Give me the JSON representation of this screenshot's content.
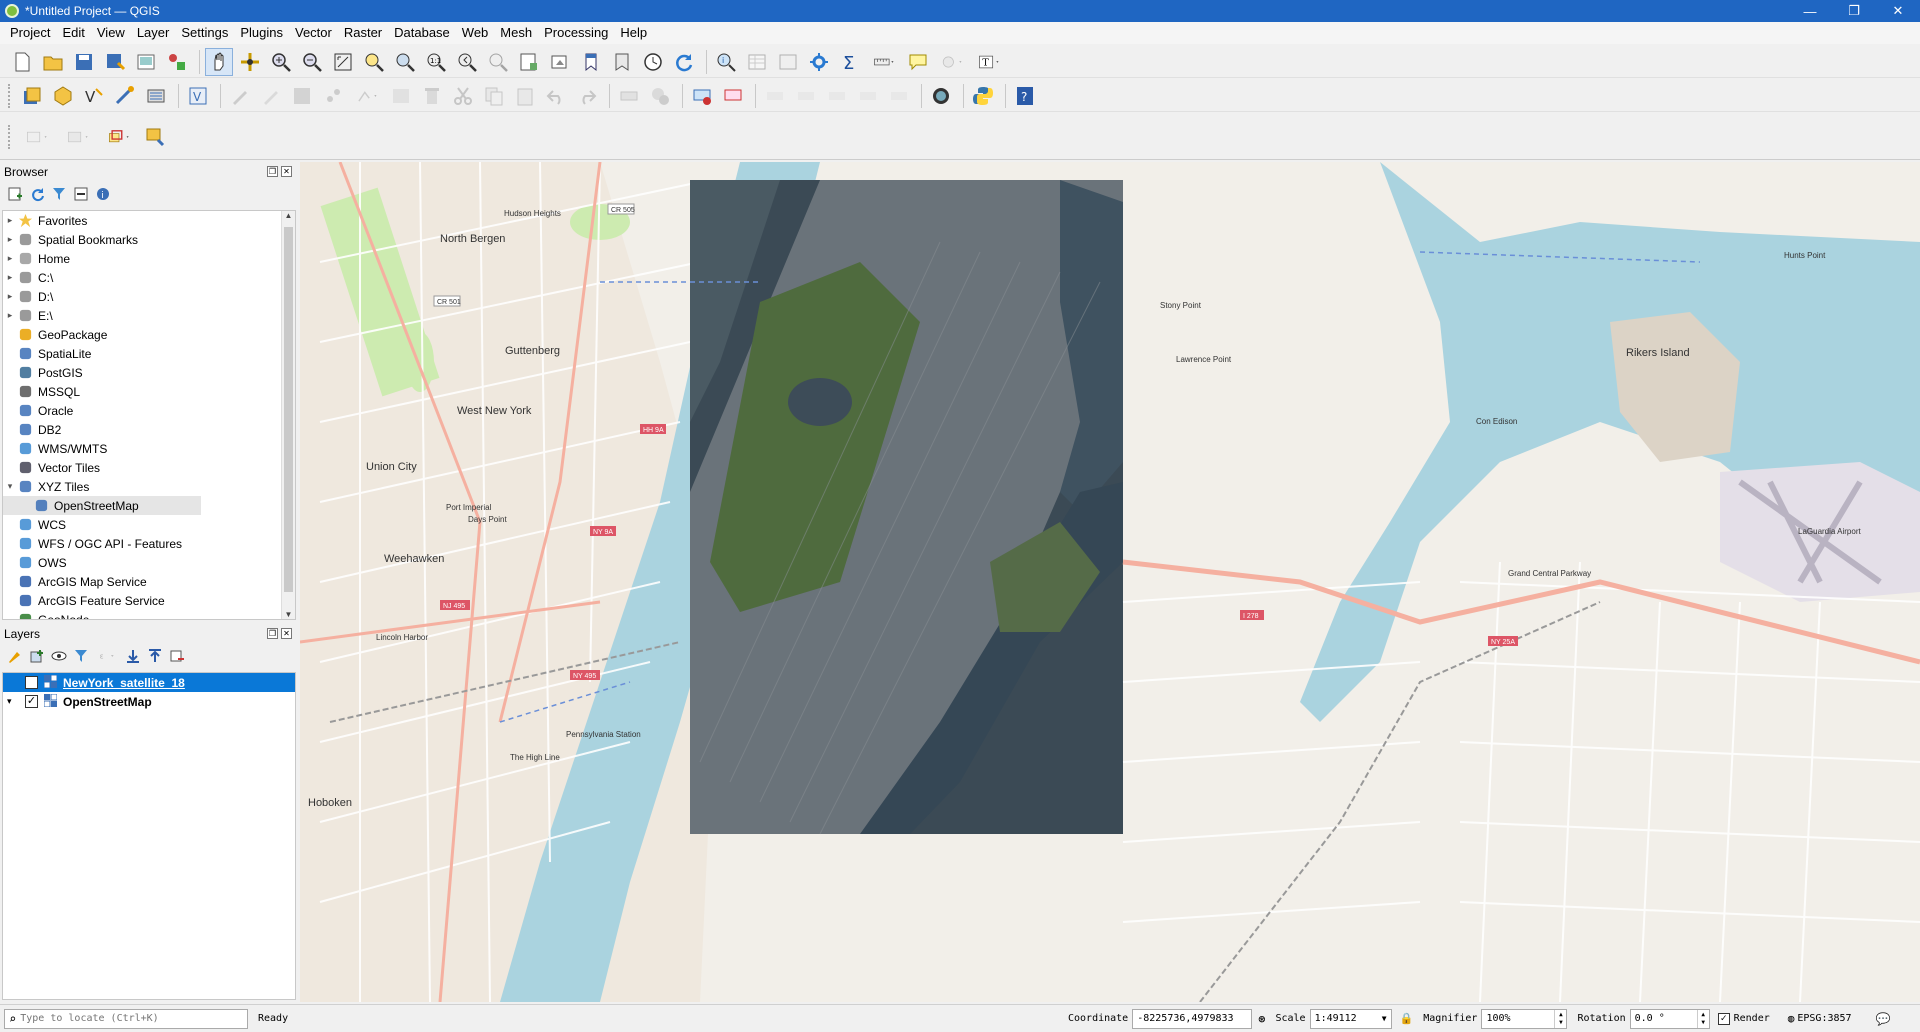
{
  "window": {
    "title": "*Untitled Project — QGIS",
    "minimize": "—",
    "maximize": "❐",
    "close": "✕"
  },
  "menu": [
    "Project",
    "Edit",
    "View",
    "Layer",
    "Settings",
    "Plugins",
    "Vector",
    "Raster",
    "Database",
    "Web",
    "Mesh",
    "Processing",
    "Help"
  ],
  "browser": {
    "title": "Browser",
    "items": [
      {
        "label": "Favorites",
        "icon": "star-icon",
        "expand": "▸"
      },
      {
        "label": "Spatial Bookmarks",
        "icon": "bookmark-icon",
        "expand": "▸"
      },
      {
        "label": "Home",
        "icon": "home-folder-icon",
        "expand": "▸"
      },
      {
        "label": "C:\\",
        "icon": "drive-icon",
        "expand": "▸"
      },
      {
        "label": "D:\\",
        "icon": "drive-icon",
        "expand": "▸"
      },
      {
        "label": "E:\\",
        "icon": "drive-icon",
        "expand": "▸"
      },
      {
        "label": "GeoPackage",
        "icon": "geopackage-icon",
        "expand": ""
      },
      {
        "label": "SpatiaLite",
        "icon": "spatialite-icon",
        "expand": ""
      },
      {
        "label": "PostGIS",
        "icon": "postgis-icon",
        "expand": ""
      },
      {
        "label": "MSSQL",
        "icon": "mssql-icon",
        "expand": ""
      },
      {
        "label": "Oracle",
        "icon": "oracle-icon",
        "expand": ""
      },
      {
        "label": "DB2",
        "icon": "db2-icon",
        "expand": ""
      },
      {
        "label": "WMS/WMTS",
        "icon": "wms-icon",
        "expand": ""
      },
      {
        "label": "Vector Tiles",
        "icon": "vector-tiles-icon",
        "expand": ""
      },
      {
        "label": "XYZ Tiles",
        "icon": "xyz-tiles-icon",
        "expand": "▾"
      },
      {
        "label": "OpenStreetMap",
        "icon": "xyz-tiles-icon",
        "expand": "",
        "indent": true
      },
      {
        "label": "WCS",
        "icon": "wcs-icon",
        "expand": ""
      },
      {
        "label": "WFS / OGC API - Features",
        "icon": "wfs-icon",
        "expand": ""
      },
      {
        "label": "OWS",
        "icon": "ows-icon",
        "expand": ""
      },
      {
        "label": "ArcGIS Map Service",
        "icon": "arcgis-icon",
        "expand": ""
      },
      {
        "label": "ArcGIS Feature Service",
        "icon": "arcgis-icon",
        "expand": ""
      },
      {
        "label": "GeoNode",
        "icon": "geonode-icon",
        "expand": ""
      }
    ]
  },
  "layers": {
    "title": "Layers",
    "items": [
      {
        "name": "NewYork_satellite_18",
        "checked": "✓",
        "expand": "",
        "selected": true
      },
      {
        "name": "OpenStreetMap",
        "checked": "✓",
        "expand": "▾",
        "selected": false
      }
    ]
  },
  "map": {
    "labels": {
      "north_bergen": "North Bergen",
      "guttenberg": "Guttenberg",
      "west_new_york": "West New York",
      "union_city": "Union City",
      "weehawken": "Weehawken",
      "hoboken": "Hoboken",
      "rikers": "Rikers Island",
      "hudson_heights": "Hudson Heights",
      "high_line": "The High Line",
      "penn": "Pennsylvania Station",
      "con_edison": "Con Edison",
      "stony_point": "Stony Point",
      "lawrence_point": "Lawrence Point",
      "hunts_point": "Hunts Point",
      "grand_central_pkwy": "Grand Central Parkway",
      "laguardia": "LaGuardia Airport",
      "port_imperial": "Port Imperial",
      "days_point": "Days Point",
      "lincoln_harbor": "Lincoln Harbor",
      "nj495": "NJ 495",
      "ny9a": "NY 9A",
      "ny495": "NY 495",
      "i278": "I 278",
      "cr505": "CR 505",
      "cr501": "CR 501",
      "ny25a": "NY 25A",
      "hh9a": "HH 9A"
    }
  },
  "status": {
    "locate_placeholder": "Type to locate (Ctrl+K)",
    "ready": "Ready",
    "coordinate_label": "Coordinate",
    "coordinate_value": "-8225736,4979833",
    "scale_label": "Scale",
    "scale_value": "1:49112",
    "magnifier_label": "Magnifier",
    "magnifier_value": "100%",
    "rotation_label": "Rotation",
    "rotation_value": "0.0 °",
    "render_label": "Render",
    "render_checked": "✓",
    "crs": "EPSG:3857"
  },
  "colors": {
    "titlebar": "#1f66c2",
    "water": "#aad3df",
    "land": "#f2efe9",
    "park": "#cdebb0",
    "selection": "#0a78d7"
  }
}
